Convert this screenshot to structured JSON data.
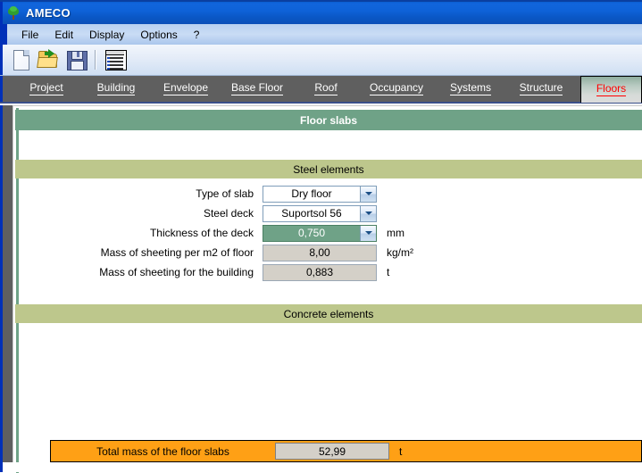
{
  "window": {
    "title": "AMECO",
    "icon": "tree-icon"
  },
  "menu": {
    "items": [
      {
        "label": "File"
      },
      {
        "label": "Edit"
      },
      {
        "label": "Display"
      },
      {
        "label": "Options"
      },
      {
        "label": "?"
      }
    ]
  },
  "toolbar": {
    "buttons": [
      {
        "icon": "new-document-icon",
        "name": "new-button"
      },
      {
        "icon": "open-folder-icon",
        "name": "open-button"
      },
      {
        "icon": "save-floppy-icon",
        "name": "save-button"
      },
      {
        "icon": "report-list-icon",
        "name": "report-button"
      }
    ]
  },
  "tabs": {
    "active_index": 8,
    "items": [
      {
        "label": "Project"
      },
      {
        "label": "Building"
      },
      {
        "label": "Envelope"
      },
      {
        "label": "Base Floor"
      },
      {
        "label": "Roof"
      },
      {
        "label": "Occupancy"
      },
      {
        "label": "Systems"
      },
      {
        "label": "Structure"
      },
      {
        "label": "Floors"
      }
    ]
  },
  "page": {
    "title": "Floor slabs",
    "groups": {
      "steel": "Steel elements",
      "concrete": "Concrete elements"
    },
    "fields": {
      "type_of_slab": {
        "label": "Type of slab",
        "value": "Dry floor",
        "unit": ""
      },
      "steel_deck": {
        "label": "Steel deck",
        "value": "Suportsol 56",
        "unit": ""
      },
      "thickness_of_deck": {
        "label": "Thickness of the deck",
        "value": "0,750",
        "unit": "mm"
      },
      "mass_per_m2": {
        "label": "Mass of sheeting per m2 of floor",
        "value": "8,00",
        "unit": "kg/m²"
      },
      "mass_building": {
        "label": "Mass of sheeting for the building",
        "value": "0,883",
        "unit": "t"
      }
    },
    "total": {
      "label": "Total mass of the floor slabs",
      "value": "52,99",
      "unit": "t"
    }
  },
  "colors": {
    "title_bar": "#0e62d8",
    "tab_bar": "#5f5f5f",
    "section_band": "#6fa287",
    "group_band": "#bdc78c",
    "total_bar": "#ffa015",
    "active_tab_text": "#ff0000"
  }
}
